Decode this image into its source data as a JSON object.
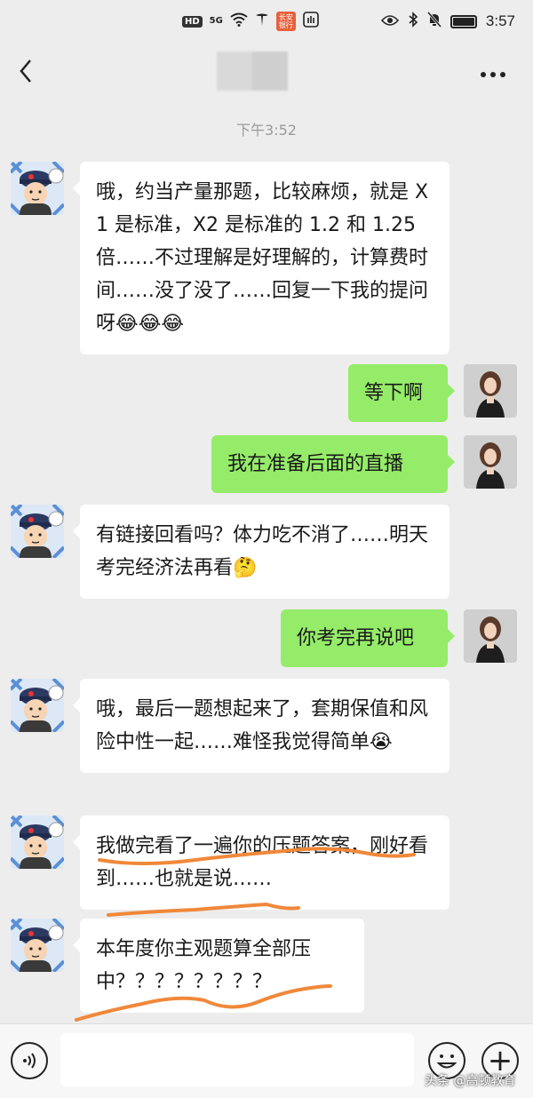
{
  "status_bar": {
    "hd": "HD",
    "signal": "5G",
    "app_badge": "长安\n银行",
    "time": "3:57"
  },
  "nav": {
    "back_icon": "chevron-left-icon",
    "more_icon": "more-dots-icon"
  },
  "chat": {
    "timestamp": "下午3:52",
    "messages": [
      {
        "side": "left",
        "text": "哦，约当产量那题，比较麻烦，就是 X1 是标准，X2 是标准的 1.2 和 1.25 倍……不过理解是好理解的，计算费时间……没了没了……回复一下我的提问呀",
        "emoji": "😂😂😂"
      },
      {
        "side": "right",
        "text": "等下啊"
      },
      {
        "side": "right",
        "text": "我在准备后面的直播"
      },
      {
        "side": "left",
        "text": "有链接回看吗？体力吃不消了……明天考完经济法再看",
        "emoji": "🤔"
      },
      {
        "side": "right",
        "text": "你考完再说吧"
      },
      {
        "side": "left",
        "text": "哦，最后一题想起来了，套期保值和风险中性一起……难怪我觉得简单",
        "emoji": "😭"
      },
      {
        "side": "left",
        "text": "我做完看了一遍你的压题答案，刚好看到……也就是说……"
      },
      {
        "side": "left",
        "text": "本年度你主观题算全部压中？？？？？？？？"
      }
    ]
  },
  "input_bar": {
    "voice_icon": "voice-icon",
    "emoji_icon": "emoji-icon",
    "plus_icon": "plus-icon",
    "plus_glyph": "+"
  },
  "watermark": "头条 @高顿教育",
  "colors": {
    "background": "#ededed",
    "bubble_self": "#95ec69",
    "bubble_other": "#ffffff",
    "scribble": "#f0883a"
  }
}
